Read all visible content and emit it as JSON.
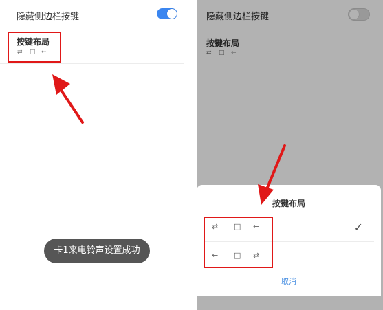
{
  "colors": {
    "accent": "#3b86f0",
    "highlight": "#e01818",
    "toast_bg": "#565656",
    "cancel": "#4a90e2",
    "toggle_off": "#cccccc"
  },
  "left": {
    "setting_title": "隐藏侧边栏按键",
    "toggle_on": true,
    "layout_title": "按键布局",
    "icons": [
      "⇄",
      "□",
      "←"
    ],
    "icon_names": [
      "swap-icon",
      "square-icon",
      "back-arrow-icon"
    ],
    "toast": "卡1来电铃声设置成功"
  },
  "right": {
    "setting_title": "隐藏侧边栏按键",
    "toggle_on": false,
    "layout_title": "按键布局",
    "icons": [
      "⇄",
      "□",
      "←"
    ],
    "dialog": {
      "title": "按键布局",
      "option1": [
        "⇄",
        "□",
        "←"
      ],
      "option2": [
        "←",
        "□",
        "⇄"
      ],
      "selected_icon": "✓",
      "cancel": "取消"
    }
  }
}
